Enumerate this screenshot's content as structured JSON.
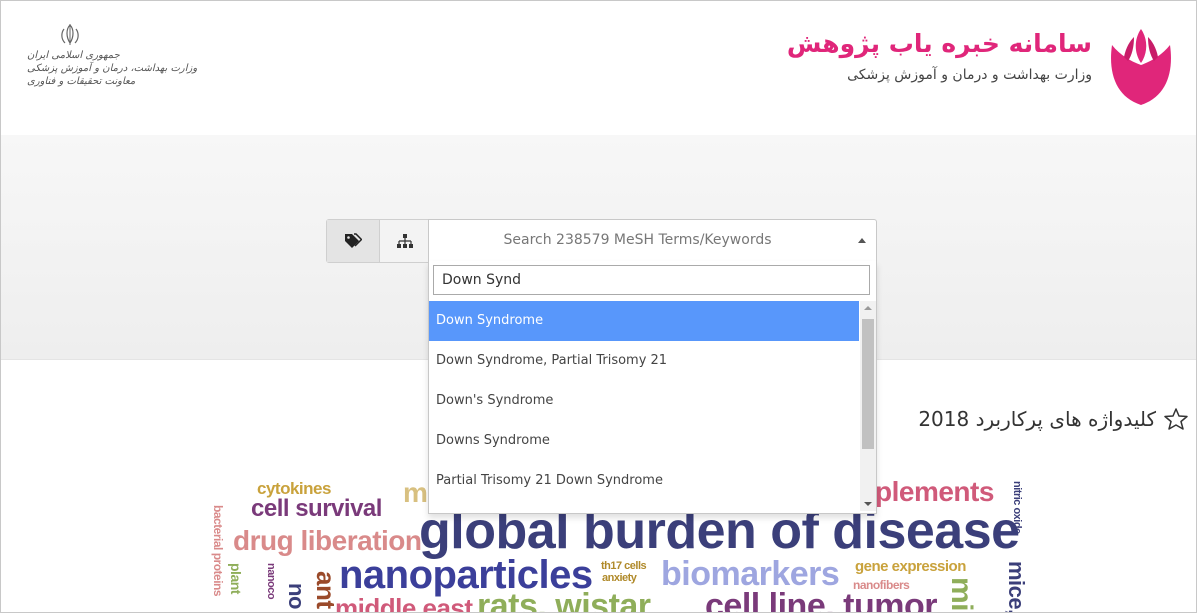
{
  "header": {
    "brand_title": "سامانه خبره یاب پژوهش",
    "brand_subtitle": "وزارت بهداشت و درمان و آموزش پزشکی",
    "emblem_lines": [
      "جمهوری اسلامی ایران",
      "وزارت بهداشت، درمان و آموزش پزشکی",
      "معاونت تحقیقات و فناوری"
    ],
    "brand_color": "#e0267a"
  },
  "search": {
    "tabs": [
      {
        "icon": "tags-icon",
        "active": true
      },
      {
        "icon": "sitemap-icon",
        "active": false
      }
    ],
    "placeholder": "Search 238579 MeSH Terms/Keywords",
    "query": "Down Synd",
    "results": [
      {
        "label": "Down Syndrome",
        "highlighted": true
      },
      {
        "label": "Down Syndrome, Partial Trisomy 21",
        "highlighted": false
      },
      {
        "label": "Down's Syndrome",
        "highlighted": false
      },
      {
        "label": "Downs Syndrome",
        "highlighted": false
      },
      {
        "label": "Partial Trisomy 21 Down Syndrome",
        "highlighted": false
      }
    ],
    "highlight_color": "#5897fb"
  },
  "keywords": {
    "heading": "کلیدواژه های پرکاربرد 2018",
    "cloud": [
      {
        "text": "cytokines",
        "color": "#c9a23c"
      },
      {
        "text": "cell survival",
        "color": "#7a3a7a"
      },
      {
        "text": "drug liberation",
        "color": "#d98a8a"
      },
      {
        "text": "global burden of disease",
        "color": "#3b3f7a"
      },
      {
        "text": "nanoparticles",
        "color": "#3b3f9a"
      },
      {
        "text": "th17 cells",
        "color": "#b08a2a"
      },
      {
        "text": "anxiety",
        "color": "#b08a2a"
      },
      {
        "text": "biomarkers",
        "color": "#9ea6e0"
      },
      {
        "text": "gene expression",
        "color": "#c9a23c"
      },
      {
        "text": "nanofibers",
        "color": "#d98a8a"
      },
      {
        "text": "plements",
        "color": "#d05a7a"
      },
      {
        "text": "nitric oxide",
        "color": "#3b3f7a"
      },
      {
        "text": "mice,",
        "color": "#3b3f7a"
      },
      {
        "text": "bacterial proteins",
        "color": "#d98a8a"
      },
      {
        "text": "plant",
        "color": "#8fae5a"
      },
      {
        "text": "nanoco",
        "color": "#7a3a7a"
      },
      {
        "text": "m",
        "color": "#d8c080"
      },
      {
        "text": "middle east",
        "color": "#d05a7a"
      },
      {
        "text": "rats, wistar",
        "color": "#8fae5a"
      },
      {
        "text": "cell line, tumor",
        "color": "#7a3a7a"
      },
      {
        "text": "ant",
        "color": "#9a4a2a"
      },
      {
        "text": "no",
        "color": "#3b3f7a"
      },
      {
        "text": "mi",
        "color": "#8fae5a"
      }
    ]
  }
}
